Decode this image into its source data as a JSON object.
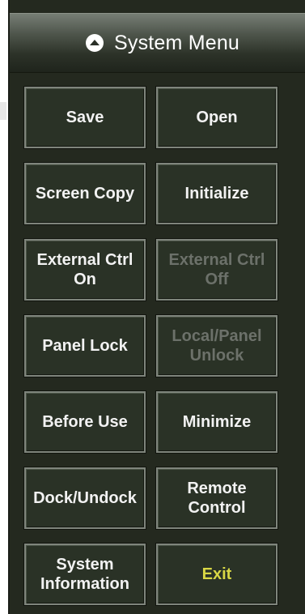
{
  "menu": {
    "title": "System Menu",
    "icon": "chevron-up-circle-icon",
    "buttons": {
      "save": {
        "label": "Save",
        "enabled": true
      },
      "open": {
        "label": "Open",
        "enabled": true
      },
      "screen_copy": {
        "label": "Screen Copy",
        "enabled": true
      },
      "initialize": {
        "label": "Initialize",
        "enabled": true
      },
      "external_ctrl_on": {
        "label": "External Ctrl\nOn",
        "enabled": true
      },
      "external_ctrl_off": {
        "label": "External Ctrl\nOff",
        "enabled": false
      },
      "panel_lock": {
        "label": "Panel Lock",
        "enabled": true
      },
      "local_panel_unlock": {
        "label": "Local/Panel\nUnlock",
        "enabled": false
      },
      "before_use": {
        "label": "Before Use",
        "enabled": true
      },
      "minimize": {
        "label": "Minimize",
        "enabled": true
      },
      "dock_undock": {
        "label": "Dock/Undock",
        "enabled": true
      },
      "remote_control": {
        "label": "Remote\nControl",
        "enabled": true
      },
      "system_information": {
        "label": "System\nInformation",
        "enabled": true
      },
      "exit": {
        "label": "Exit",
        "enabled": true
      }
    }
  },
  "colors": {
    "panel_bg": "#24291f",
    "button_bg": "#2a3226",
    "button_border": "#7f857c",
    "text": "#f2f2f2",
    "disabled_text": "#6c716a",
    "exit_text": "#d9d845"
  }
}
